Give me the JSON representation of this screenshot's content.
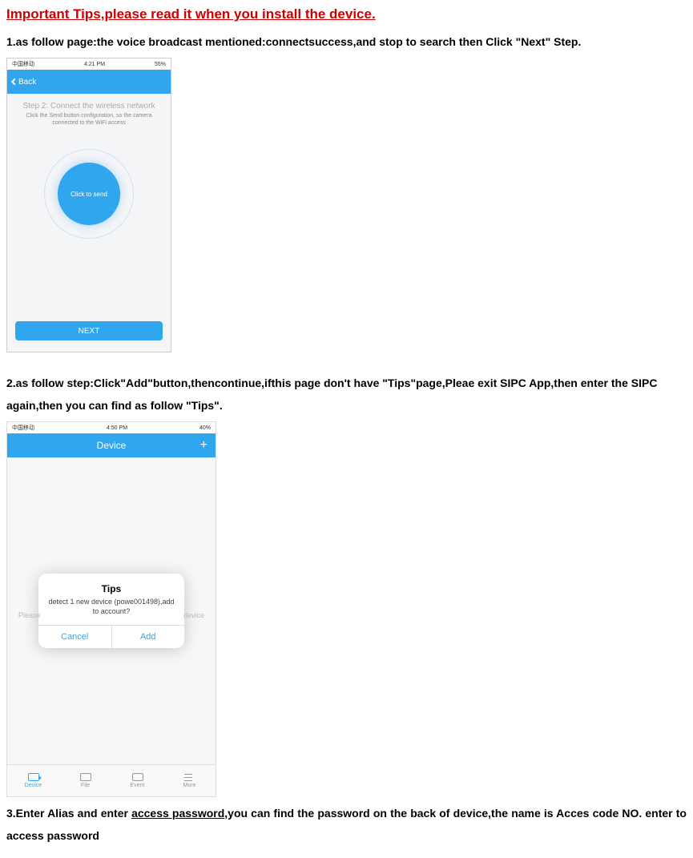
{
  "title": "Important Tips,please read it when you install the device.",
  "step1": "1.as follow page:the voice broadcast mentioned:connectsuccess,and stop to search then Click \"Next\" Step.",
  "step2": "2.as follow step:Click\"Add\"button,thencontinue,ifthis page don't have \"Tips\"page,Pleae exit SIPC App,then enter the SIPC again,then you can find as follow \"Tips\".",
  "step3_pre": "3.Enter Alias and enter ",
  "step3_under": "access password",
  "step3_post": ",you can find the password on the back of device,the name is Acces code NO. enter to access password",
  "shot1": {
    "status": {
      "carrier": "中国移动",
      "time": "4:21 PM",
      "battery": "55%"
    },
    "back": "Back",
    "step_title": "Step 2: Connect the wireless network",
    "step_sub": "Click the Send button configuration, so the camera connected to the WiFi access",
    "send": "Click to send",
    "next": "NEXT"
  },
  "shot2": {
    "status": {
      "carrier": "中国移动",
      "time": "4:50 PM",
      "battery": "40%"
    },
    "nav_title": "Device",
    "behind_left": "Please",
    "behind_right": "device",
    "dialog": {
      "title": "Tips",
      "msg": "detect 1 new device (powe001498),add to account?",
      "cancel": "Cancel",
      "add": "Add"
    },
    "tabs": [
      "Device",
      "File",
      "Event",
      "More"
    ]
  }
}
